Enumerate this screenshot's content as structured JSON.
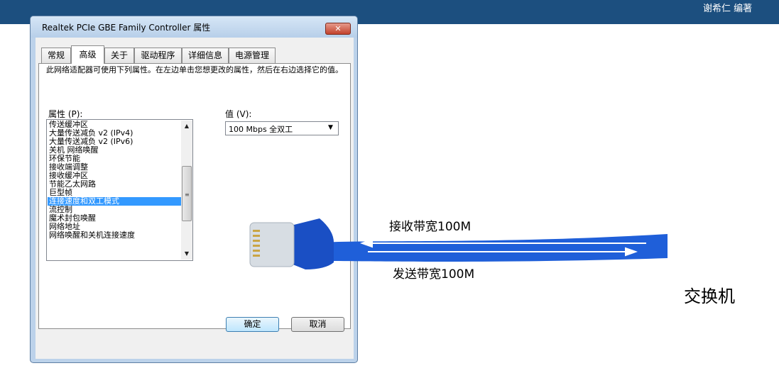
{
  "header": {
    "author": "谢希仁 编著"
  },
  "dialog": {
    "title": "Realtek PCIe GBE Family Controller 属性",
    "close_glyph": "✕",
    "tabs": [
      {
        "label": "常规"
      },
      {
        "label": "高级"
      },
      {
        "label": "关于"
      },
      {
        "label": "驱动程序"
      },
      {
        "label": "详细信息"
      },
      {
        "label": "电源管理"
      }
    ],
    "active_tab": "高级",
    "description": "此网络适配器可使用下列属性。在左边单击您想更改的属性，然后在右边选择它的值。",
    "property_label": "属性 (P):",
    "value_label": "值 (V):",
    "properties": [
      "传送缓冲区",
      "大量传送减负 v2 (IPv4)",
      "大量传送减负 v2 (IPv6)",
      "关机 网络唤醒",
      "环保节能",
      "接收端调整",
      "接收缓冲区",
      "节能乙太网路",
      "巨型帧",
      "连接速度和双工模式",
      "流控制",
      "魔术封包唤醒",
      "网络地址",
      "网络唤醒和关机连接速度"
    ],
    "selected_property": "连接速度和双工模式",
    "selected_value": "100 Mbps 全双工",
    "scroll_up_glyph": "▲",
    "scroll_down_glyph": "▼",
    "scroll_grip_glyph": "≡",
    "dropdown_glyph": "▼",
    "ok_button": "确定",
    "cancel_button": "取消"
  },
  "illustration": {
    "receive_label": "接收带宽100M",
    "send_label": "发送带宽100M",
    "switch_label": "交换机",
    "cable_color": "#1f5fd9",
    "arrow_color": "#ffffff"
  }
}
